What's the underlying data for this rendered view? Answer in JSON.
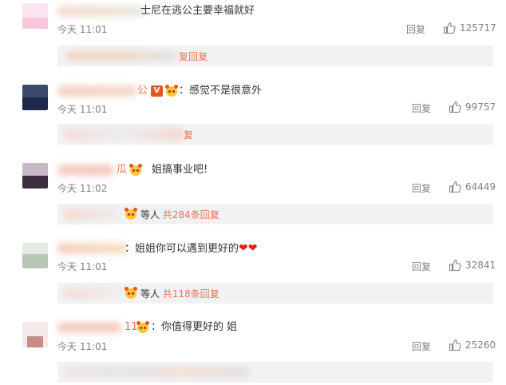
{
  "comments": [
    {
      "name_visible": "",
      "text": "士尼在逃公主要幸福就好",
      "time": "今天 11:01",
      "reply_label": "回复",
      "likes": "125717",
      "sub": {
        "suffix": "",
        "link": "复回复"
      }
    },
    {
      "name_visible": "公",
      "text": "：感觉不是很意外",
      "time": "今天 11:01",
      "reply_label": "回复",
      "likes": "99757",
      "sub": {
        "suffix": "",
        "link": "复"
      }
    },
    {
      "name_visible": "瓜",
      "text": "姐搞事业吧!",
      "time": "今天 11:02",
      "reply_label": "回复",
      "likes": "64449",
      "sub": {
        "suffix": "等人",
        "link": "共284条回复"
      }
    },
    {
      "name_visible": "",
      "text": "：姐姐你可以遇到更好的",
      "time": "今天 11:01",
      "reply_label": "回复",
      "likes": "32841",
      "sub": {
        "suffix": "等人",
        "link": "共118条回复"
      }
    },
    {
      "name_visible": "11",
      "text": "：你值得更好的 姐",
      "time": "今天 11:01",
      "reply_label": "回复",
      "likes": "25260",
      "sub": {
        "suffix": "",
        "link": ""
      }
    }
  ],
  "colors": {
    "link": "#eb7350",
    "muted": "#808080",
    "text": "#333333",
    "sub_bar_bg": "#f2f2f5"
  },
  "icons": {
    "like": "thumbs-up-icon",
    "vip": "vip-badge-icon",
    "fan": "fan-badge-icon",
    "heart": "heart-icon"
  }
}
